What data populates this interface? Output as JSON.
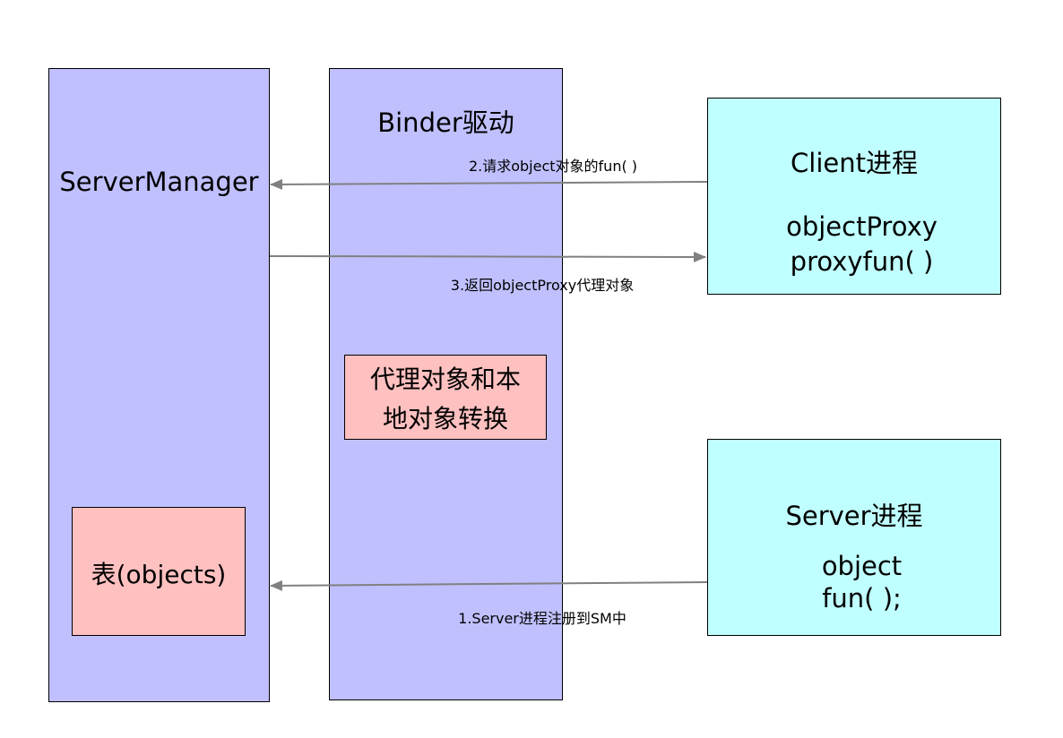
{
  "server_manager": {
    "title": "ServerManager",
    "table_label": "表(objects)"
  },
  "binder": {
    "title": "Binder驱动",
    "conversion_line1": "代理对象和本",
    "conversion_line2": "地对象转换"
  },
  "client_process": {
    "title": "Client进程",
    "line1": "objectProxy",
    "line2": "proxyfun( )"
  },
  "server_process": {
    "title": "Server进程",
    "line1": "object",
    "line2": "fun( );"
  },
  "arrows": {
    "step1": "1.Server进程注册到SM中",
    "step2": "2.请求object对象的fun( )",
    "step3": "3.返回objectProxy代理对象"
  },
  "colors": {
    "server_manager_fill": "#c0c0ff",
    "binder_fill": "#c0c0ff",
    "process_fill": "#c0ffff",
    "highlight_fill": "#ffc0c0",
    "arrow": "#808080"
  }
}
